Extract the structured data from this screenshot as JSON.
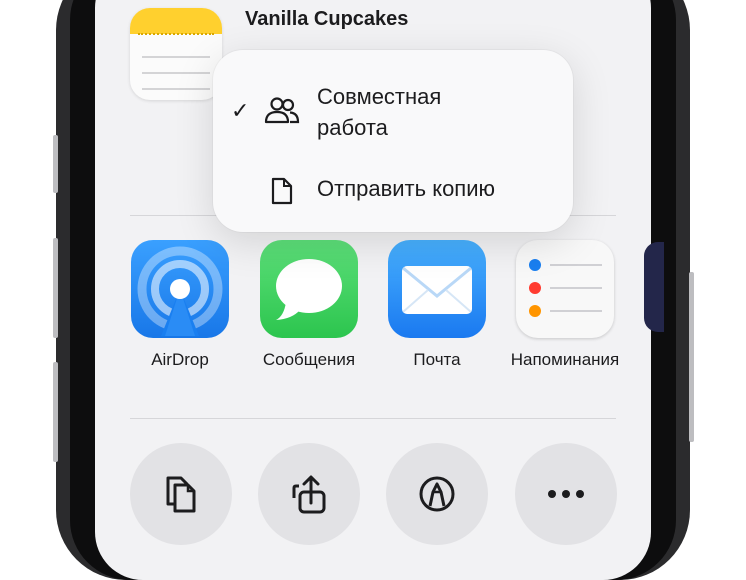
{
  "note": {
    "title": "Vanilla Cupcakes",
    "icon": "notes-app-icon"
  },
  "menu": {
    "items": [
      {
        "label_line1": "Совместная",
        "label_line2": "работа",
        "icon": "collaborate-people-icon",
        "checked": true
      },
      {
        "label": "Отправить копию",
        "icon": "document-icon",
        "checked": false
      }
    ],
    "checkmark": "✓"
  },
  "apps": [
    {
      "label": "AirDrop",
      "icon": "airdrop-icon",
      "color": "#1877e8"
    },
    {
      "label": "Сообщения",
      "icon": "messages-icon",
      "color": "#2cc54e"
    },
    {
      "label": "Почта",
      "icon": "mail-icon",
      "color": "#1a79f0"
    },
    {
      "label": "Напоминания",
      "icon": "reminders-icon",
      "color": "#f8f8f8"
    }
  ],
  "actions": [
    {
      "icon": "copy-icon"
    },
    {
      "icon": "export-icon"
    },
    {
      "icon": "markup-icon"
    },
    {
      "icon": "more-icon"
    }
  ]
}
